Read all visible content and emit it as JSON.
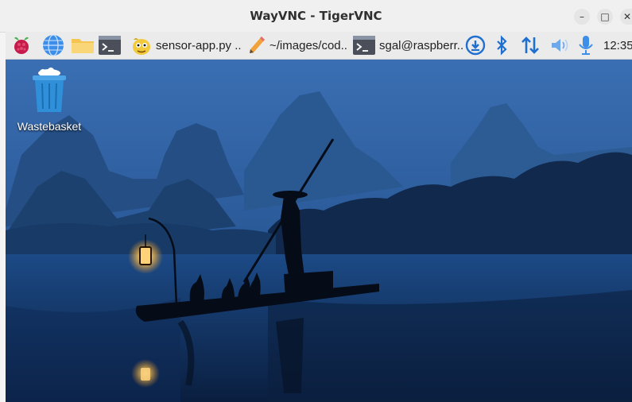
{
  "window": {
    "title": "WayVNC - TigerVNC",
    "controls": {
      "minimize": "–",
      "maximize": "□",
      "close": "✕"
    }
  },
  "taskbar": {
    "apps": [
      {
        "name": "raspberry-menu",
        "icon": "raspberry-icon"
      },
      {
        "name": "browser",
        "icon": "globe-icon"
      },
      {
        "name": "file-manager",
        "icon": "folder-icon"
      },
      {
        "name": "terminal",
        "icon": "terminal-icon"
      }
    ],
    "windows": [
      {
        "icon": "thonny-icon",
        "label": "sensor-app.py .."
      },
      {
        "icon": "pencil-icon",
        "label": "~/images/cod.."
      },
      {
        "icon": "terminal-icon",
        "label": "sgal@raspberr.."
      }
    ],
    "tray": [
      "download-icon",
      "bluetooth-icon",
      "network-icon",
      "volume-icon",
      "microphone-icon"
    ],
    "clock": "12:35"
  },
  "desktop": {
    "icons": [
      {
        "label": "Wastebasket",
        "icon": "trash-icon"
      }
    ],
    "wallpaper": "river-fisherman-at-dusk"
  },
  "colors": {
    "accent": "#1e6fd0",
    "wallpaper_sky": "#2f5e9e",
    "wallpaper_water": "#0d2a55",
    "lantern": "#ffd27a"
  }
}
